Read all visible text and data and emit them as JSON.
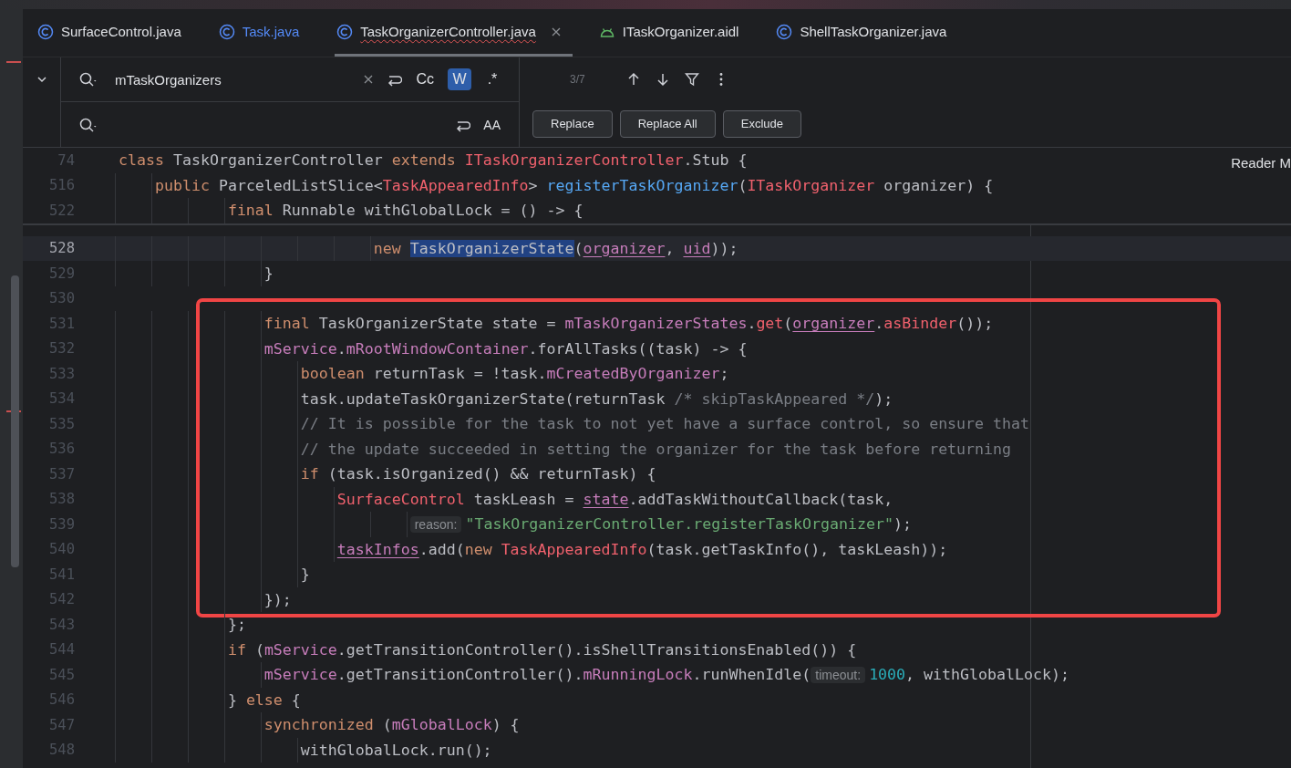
{
  "tabs": [
    {
      "label": "SurfaceControl.java",
      "kind": "class",
      "selected": false,
      "modified": false,
      "has_errors": false
    },
    {
      "label": "Task.java",
      "kind": "class",
      "selected": false,
      "modified": true,
      "has_errors": false
    },
    {
      "label": "TaskOrganizerController.java",
      "kind": "class",
      "selected": true,
      "modified": false,
      "has_errors": true
    },
    {
      "label": "ITaskOrganizer.aidl",
      "kind": "android",
      "selected": false,
      "modified": false,
      "has_errors": false
    },
    {
      "label": "ShellTaskOrganizer.java",
      "kind": "class",
      "selected": false,
      "modified": false,
      "has_errors": false
    }
  ],
  "find": {
    "query": "mTaskOrganizers",
    "match_count": "3/7",
    "options": [
      {
        "label": "Cc",
        "selected": false
      },
      {
        "label": "W",
        "selected": true
      },
      {
        "label": ".*",
        "selected": false
      }
    ],
    "preserve_case": "AA",
    "buttons": [
      "Replace",
      "Replace All",
      "Exclude"
    ]
  },
  "reader_mode": "Reader M",
  "sticky_lines": [
    {
      "number": "74",
      "tokens": [
        {
          "kind": "kw",
          "text": "class "
        },
        {
          "kind": "plain",
          "text": "TaskOrganizerController "
        },
        {
          "kind": "kw",
          "text": "extends "
        },
        {
          "kind": "type",
          "text": "ITaskOrganizerController"
        },
        {
          "kind": "plain",
          "text": ".Stub {"
        }
      ]
    },
    {
      "number": "516",
      "tokens": [
        {
          "kind": "kw",
          "text": "    public "
        },
        {
          "kind": "plain",
          "text": "ParceledListSlice<"
        },
        {
          "kind": "type",
          "text": "TaskAppearedInfo"
        },
        {
          "kind": "plain",
          "text": "> "
        },
        {
          "kind": "method",
          "text": "registerTaskOrganizer"
        },
        {
          "kind": "plain",
          "text": "("
        },
        {
          "kind": "type",
          "text": "ITaskOrganizer"
        },
        {
          "kind": "plain",
          "text": " organizer) {"
        }
      ]
    },
    {
      "number": "522",
      "tokens": [
        {
          "kind": "kw",
          "text": "            final "
        },
        {
          "kind": "plain",
          "text": "Runnable withGlobalLock = () -> {"
        }
      ]
    }
  ],
  "lines": [
    {
      "kind": "line",
      "number": "528",
      "current": true,
      "tokens": [
        {
          "kind": "kw",
          "text": "                            new "
        },
        {
          "kind": "match",
          "text": "TaskOrganizerState"
        },
        {
          "kind": "plain",
          "text": "("
        },
        {
          "kind": "captured",
          "text": "organizer"
        },
        {
          "kind": "plain",
          "text": ", "
        },
        {
          "kind": "captured",
          "text": "uid"
        },
        {
          "kind": "plain",
          "text": "));"
        }
      ]
    },
    {
      "kind": "line",
      "number": "529",
      "current": false,
      "tokens": [
        {
          "kind": "plain",
          "text": "                }"
        }
      ]
    },
    {
      "kind": "line",
      "number": "530",
      "current": false
    },
    {
      "kind": "boxed_group",
      "lines": [
        {
          "kind": "line",
          "number": "531",
          "current": false,
          "tokens": [
            {
              "kind": "kw",
              "text": "                final "
            },
            {
              "kind": "plain",
              "text": "TaskOrganizerState state = "
            },
            {
              "kind": "field",
              "text": "mTaskOrganizerStates"
            },
            {
              "kind": "plain",
              "text": "."
            },
            {
              "kind": "type",
              "text": "get"
            },
            {
              "kind": "plain",
              "text": "("
            },
            {
              "kind": "captured",
              "text": "organizer"
            },
            {
              "kind": "plain",
              "text": "."
            },
            {
              "kind": "type",
              "text": "asBinder"
            },
            {
              "kind": "plain",
              "text": "());"
            }
          ]
        },
        {
          "kind": "line",
          "number": "532",
          "current": false,
          "tokens": [
            {
              "kind": "field",
              "text": "                mService"
            },
            {
              "kind": "plain",
              "text": "."
            },
            {
              "kind": "field",
              "text": "mRootWindowContainer"
            },
            {
              "kind": "plain",
              "text": ".forAllTasks((task) -> {"
            }
          ]
        },
        {
          "kind": "line",
          "number": "533",
          "current": false,
          "tokens": [
            {
              "kind": "kw",
              "text": "                    boolean "
            },
            {
              "kind": "plain",
              "text": "returnTask = !task."
            },
            {
              "kind": "field",
              "text": "mCreatedByOrganizer"
            },
            {
              "kind": "plain",
              "text": ";"
            }
          ]
        },
        {
          "kind": "line",
          "number": "534",
          "current": false,
          "tokens": [
            {
              "kind": "plain",
              "text": "                    task.updateTaskOrganizerState(returnTask "
            },
            {
              "kind": "comment",
              "text": "/* skipTaskAppeared */"
            },
            {
              "kind": "plain",
              "text": ");"
            }
          ]
        },
        {
          "kind": "line",
          "number": "535",
          "current": false,
          "tokens": [
            {
              "kind": "comment",
              "text": "                    // It is possible for the task to not yet have a surface control, so ensure that"
            }
          ]
        },
        {
          "kind": "line",
          "number": "536",
          "current": false,
          "tokens": [
            {
              "kind": "comment",
              "text": "                    // the update succeeded in setting the organizer for the task before returning"
            }
          ]
        },
        {
          "kind": "line",
          "number": "537",
          "current": false,
          "tokens": [
            {
              "kind": "kw",
              "text": "                    if "
            },
            {
              "kind": "plain",
              "text": "(task.isOrganized() && returnTask) {"
            }
          ]
        },
        {
          "kind": "line",
          "number": "538",
          "current": false,
          "tokens": [
            {
              "kind": "type",
              "text": "                        SurfaceControl"
            },
            {
              "kind": "plain",
              "text": " taskLeash = "
            },
            {
              "kind": "captured",
              "text": "state"
            },
            {
              "kind": "plain",
              "text": ".addTaskWithoutCallback(task,"
            }
          ]
        },
        {
          "kind": "line",
          "number": "539",
          "current": false,
          "tokens": [
            {
              "kind": "hint",
              "text": "                                reason:"
            },
            {
              "kind": "string",
              "text": "\"TaskOrganizerController.registerTaskOrganizer\""
            },
            {
              "kind": "plain",
              "text": ");"
            }
          ]
        },
        {
          "kind": "line",
          "number": "540",
          "current": false,
          "tokens": [
            {
              "kind": "captured",
              "text": "                        taskInfos"
            },
            {
              "kind": "plain",
              "text": ".add("
            },
            {
              "kind": "kw",
              "text": "new "
            },
            {
              "kind": "type",
              "text": "TaskAppearedInfo"
            },
            {
              "kind": "plain",
              "text": "(task.getTaskInfo(), taskLeash));"
            }
          ]
        },
        {
          "kind": "line",
          "number": "541",
          "current": false,
          "tokens": [
            {
              "kind": "plain",
              "text": "                    }"
            }
          ]
        },
        {
          "kind": "line",
          "number": "542",
          "current": false,
          "tokens": [
            {
              "kind": "plain",
              "text": "                });"
            }
          ]
        }
      ]
    },
    {
      "kind": "line",
      "number": "543",
      "current": false,
      "tokens": [
        {
          "kind": "plain",
          "text": "            };"
        }
      ]
    },
    {
      "kind": "line",
      "number": "544",
      "current": false,
      "tokens": [
        {
          "kind": "kw",
          "text": "            if "
        },
        {
          "kind": "plain",
          "text": "("
        },
        {
          "kind": "field",
          "text": "mService"
        },
        {
          "kind": "plain",
          "text": ".getTransitionController().isShellTransitionsEnabled()) {"
        }
      ]
    },
    {
      "kind": "line",
      "number": "545",
      "current": false,
      "tokens": [
        {
          "kind": "field",
          "text": "                mService"
        },
        {
          "kind": "plain",
          "text": ".getTransitionController()."
        },
        {
          "kind": "field",
          "text": "mRunningLock"
        },
        {
          "kind": "plain",
          "text": ".runWhenIdle("
        },
        {
          "kind": "hint",
          "text": "timeout:"
        },
        {
          "kind": "number",
          "text": "1000"
        },
        {
          "kind": "plain",
          "text": ", withGlobalLock);"
        }
      ]
    },
    {
      "kind": "line",
      "number": "546",
      "current": false,
      "tokens": [
        {
          "kind": "plain",
          "text": "            } "
        },
        {
          "kind": "kw",
          "text": "else "
        },
        {
          "kind": "plain",
          "text": "{"
        }
      ]
    },
    {
      "kind": "line",
      "number": "547",
      "current": false,
      "tokens": [
        {
          "kind": "kw",
          "text": "                synchronized "
        },
        {
          "kind": "plain",
          "text": "("
        },
        {
          "kind": "field",
          "text": "mGlobalLock"
        },
        {
          "kind": "plain",
          "text": ") {"
        }
      ]
    },
    {
      "kind": "line",
      "number": "548",
      "current": false,
      "tokens": [
        {
          "kind": "plain",
          "text": "                    withGlobalLock.run();"
        }
      ]
    }
  ]
}
